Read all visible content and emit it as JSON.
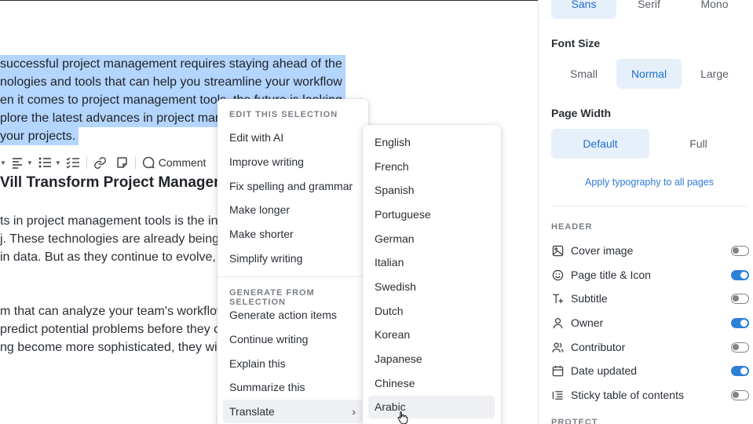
{
  "editor": {
    "selected_lines": [
      "successful project management requires staying ahead of the",
      "nologies and tools that can help you streamline your workflow",
      "en it comes to project management tools, the future is looking",
      "plore the latest advances in project mana",
      "your projects."
    ],
    "toolbar": {
      "comment_label": "Comment"
    },
    "heading": "Vill Transform Project Managem",
    "paragraph1": [
      "ts in project management tools is the int",
      "j. These technologies are already being u",
      "in data. But as they continue to evolve, t"
    ],
    "paragraph2": [
      "m that can analyze your team's workflow",
      "predict potential problems before they c",
      "ng become more sophisticated, they will"
    ]
  },
  "context_menu": {
    "section_edit": "EDIT THIS SELECTION",
    "edit_items": [
      "Edit with AI",
      "Improve writing",
      "Fix spelling and grammar",
      "Make longer",
      "Make shorter",
      "Simplify writing"
    ],
    "section_generate": "GENERATE FROM SELECTION",
    "generate_items": [
      "Generate action items",
      "Continue writing",
      "Explain this",
      "Summarize this"
    ],
    "translate_label": "Translate",
    "translate_chevron": "›"
  },
  "translate_submenu": {
    "languages": [
      "English",
      "French",
      "Spanish",
      "Portuguese",
      "German",
      "Italian",
      "Swedish",
      "Dutch",
      "Korean",
      "Japanese",
      "Chinese",
      "Arabic"
    ],
    "hovered": "Arabic"
  },
  "panel": {
    "font_options": [
      "Sans",
      "Serif",
      "Mono"
    ],
    "font_selected": "Sans",
    "font_size_label": "Font Size",
    "size_options": [
      "Small",
      "Normal",
      "Large"
    ],
    "size_selected": "Normal",
    "page_width_label": "Page Width",
    "width_options": [
      "Default",
      "Full"
    ],
    "width_selected": "Default",
    "apply_link": "Apply typography to all pages",
    "header_caption": "HEADER",
    "header_rows": [
      {
        "label": "Cover image",
        "icon": "image-icon",
        "on": false
      },
      {
        "label": "Page title & Icon",
        "icon": "smiley-icon",
        "on": true
      },
      {
        "label": "Subtitle",
        "icon": "text-plus-icon",
        "on": false
      },
      {
        "label": "Owner",
        "icon": "user-icon",
        "on": true
      },
      {
        "label": "Contributor",
        "icon": "users-icon",
        "on": false
      },
      {
        "label": "Date updated",
        "icon": "calendar-icon",
        "on": true
      },
      {
        "label": "Sticky table of contents",
        "icon": "list-icon",
        "on": false
      }
    ],
    "protect_caption": "PROTECT"
  },
  "colors": {
    "selection": "#b4d5fe",
    "accent": "#2d7fd8",
    "accent_bg": "#e6f0fb",
    "link": "#2e7bd6"
  }
}
